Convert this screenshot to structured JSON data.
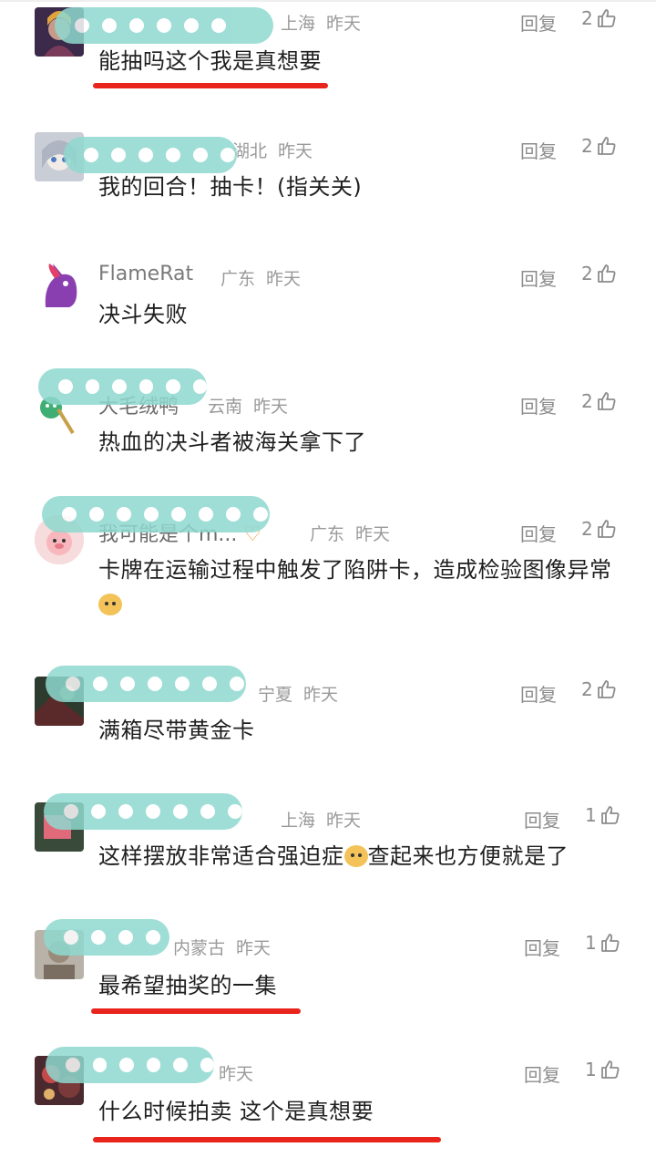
{
  "comments": [
    {
      "name": "",
      "location": "上海",
      "time": "昨天",
      "reply": "回复",
      "likes": "2",
      "text": "能抽吗这个我是真想要"
    },
    {
      "name": "",
      "location": "湖北",
      "time": "昨天",
      "reply": "回复",
      "likes": "2",
      "text": "我的回合！抽卡！(指关关)"
    },
    {
      "name": "FlameRat",
      "location": "广东",
      "time": "昨天",
      "reply": "回复",
      "likes": "2",
      "text": "决斗失败"
    },
    {
      "name": "大毛绒鸭",
      "location": "云南",
      "time": "昨天",
      "reply": "回复",
      "likes": "2",
      "text": "热血的决斗者被海关拿下了"
    },
    {
      "name": "我可能是个m...",
      "location": "广东",
      "time": "昨天",
      "reply": "回复",
      "likes": "2",
      "text": "卡牌在运输过程中触发了陷阱卡，造成检验图像异常"
    },
    {
      "name": "",
      "location": "宁夏",
      "time": "昨天",
      "reply": "回复",
      "likes": "2",
      "text": "满箱尽带黄金卡"
    },
    {
      "name": "",
      "location": "上海",
      "time": "昨天",
      "reply": "回复",
      "likes": "1",
      "text": "这样摆放非常适合强迫症",
      "text_after_emoji": "查起来也方便就是了"
    },
    {
      "name": "",
      "location": "内蒙古",
      "time": "昨天",
      "reply": "回复",
      "likes": "1",
      "text": "最希望抽奖的一集"
    },
    {
      "name": "",
      "location": "",
      "time": "昨天",
      "reply": "回复",
      "likes": "1",
      "text": "什么时候拍卖 这个是真想要"
    }
  ],
  "icons": {
    "like": "thumbs-up-icon",
    "emoji": "doge-emoji-icon"
  },
  "colors": {
    "underline": "#e8241c",
    "blur_mask": "#8fd9cf",
    "meta": "#9a9a9a"
  }
}
